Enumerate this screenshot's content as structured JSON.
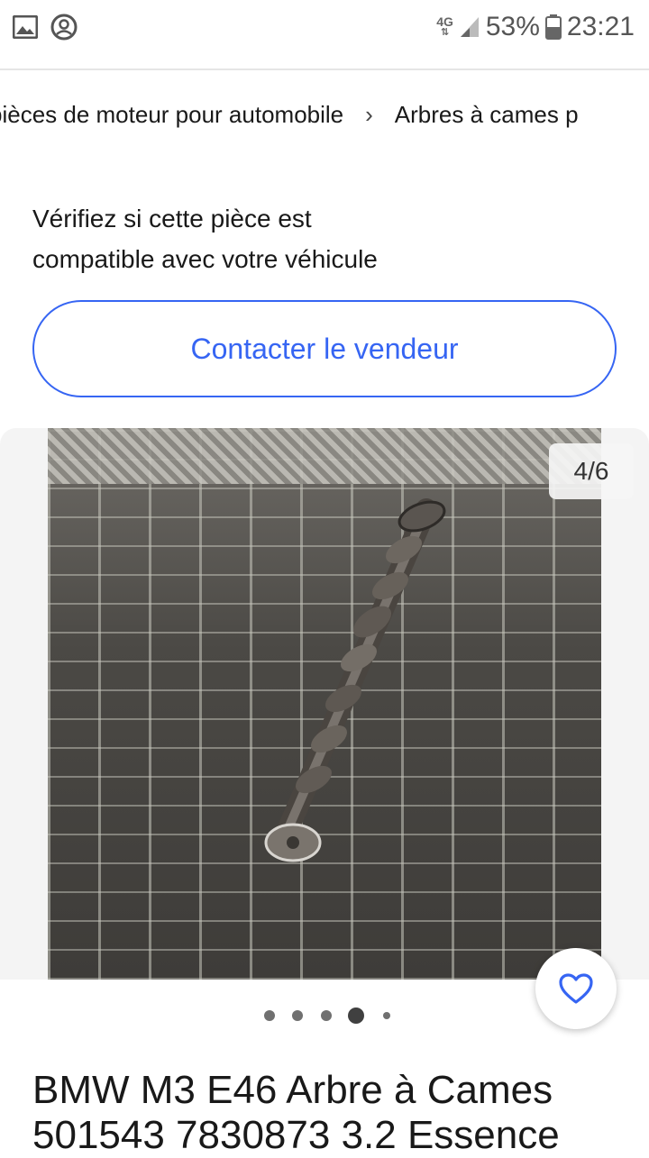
{
  "status_bar": {
    "network": "4G",
    "battery": "53%",
    "time": "23:21",
    "left_icons": [
      "image-icon",
      "account-circle-icon"
    ]
  },
  "breadcrumb": {
    "items": [
      "pièces de moteur pour automobile",
      "Arbres à cames p"
    ],
    "separator": "›"
  },
  "compat": {
    "text_line1": "Vérifiez si cette pièce est",
    "text_line2": "compatible avec votre véhicule"
  },
  "contact_button": {
    "label": "Contacter le vendeur"
  },
  "gallery": {
    "counter": "4/6",
    "current_index": 4,
    "total": 6,
    "favorite_icon": "heart-outline-icon"
  },
  "listing": {
    "title_line1": "BMW M3 E46 Arbre à Cames",
    "title_line2": "501543 7830873 3.2 Essence"
  },
  "colors": {
    "accent": "#3665f3",
    "text": "#191919"
  }
}
